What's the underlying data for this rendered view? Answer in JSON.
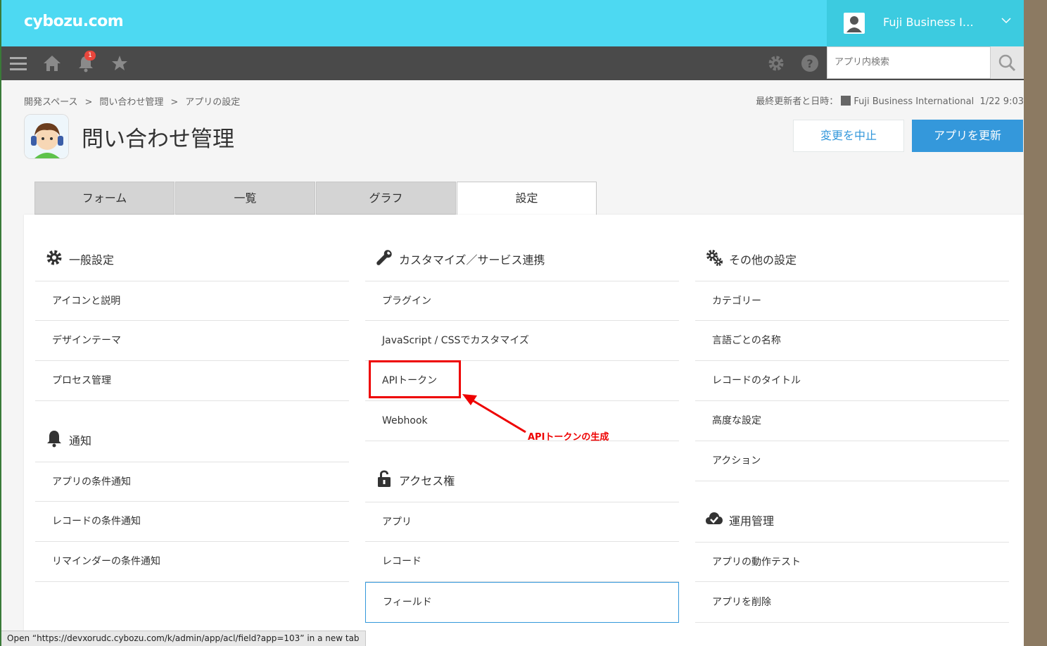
{
  "header": {
    "logo": "cybozu.com",
    "user_name": "Fuji Business I…"
  },
  "nav": {
    "notification_count": "1",
    "search_placeholder": "アプリ内検索"
  },
  "breadcrumb": [
    "開発スペース",
    "問い合わせ管理",
    "アプリの設定"
  ],
  "breadcrumb_sep": ">",
  "updated": {
    "label": "最終更新者と日時：",
    "user": "Fuji Business International",
    "datetime": "1/22 9:03"
  },
  "app": {
    "title": "問い合わせ管理",
    "cancel_label": "変更を中止",
    "update_label": "アプリを更新"
  },
  "tabs": [
    {
      "label": "フォーム",
      "active": false
    },
    {
      "label": "一覧",
      "active": false
    },
    {
      "label": "グラフ",
      "active": false
    },
    {
      "label": "設定",
      "active": true
    }
  ],
  "sections": {
    "general": {
      "title": "一般設定",
      "items": [
        "アイコンと説明",
        "デザインテーマ",
        "プロセス管理"
      ]
    },
    "notification": {
      "title": "通知",
      "items": [
        "アプリの条件通知",
        "レコードの条件通知",
        "リマインダーの条件通知"
      ]
    },
    "customize": {
      "title": "カスタマイズ／サービス連携",
      "items": [
        "プラグイン",
        "JavaScript / CSSでカスタマイズ",
        "APIトークン",
        "Webhook"
      ]
    },
    "access": {
      "title": "アクセス権",
      "items": [
        "アプリ",
        "レコード",
        "フィールド"
      ]
    },
    "other": {
      "title": "その他の設定",
      "items": [
        "カテゴリー",
        "言語ごとの名称",
        "レコードのタイトル",
        "高度な設定",
        "アクション"
      ]
    },
    "operation": {
      "title": "運用管理",
      "items": [
        "アプリの動作テスト",
        "アプリを削除"
      ]
    }
  },
  "annotation": {
    "text": "APIトークンの生成",
    "color": "#e00000"
  },
  "status_bar": {
    "text": "Open “https://devxorudc.cybozu.com/k/admin/app/acl/field?app=103” in a new tab"
  },
  "colors": {
    "header": "#4dd9f2",
    "nav": "#4a4a4a",
    "primary": "#3498db"
  }
}
